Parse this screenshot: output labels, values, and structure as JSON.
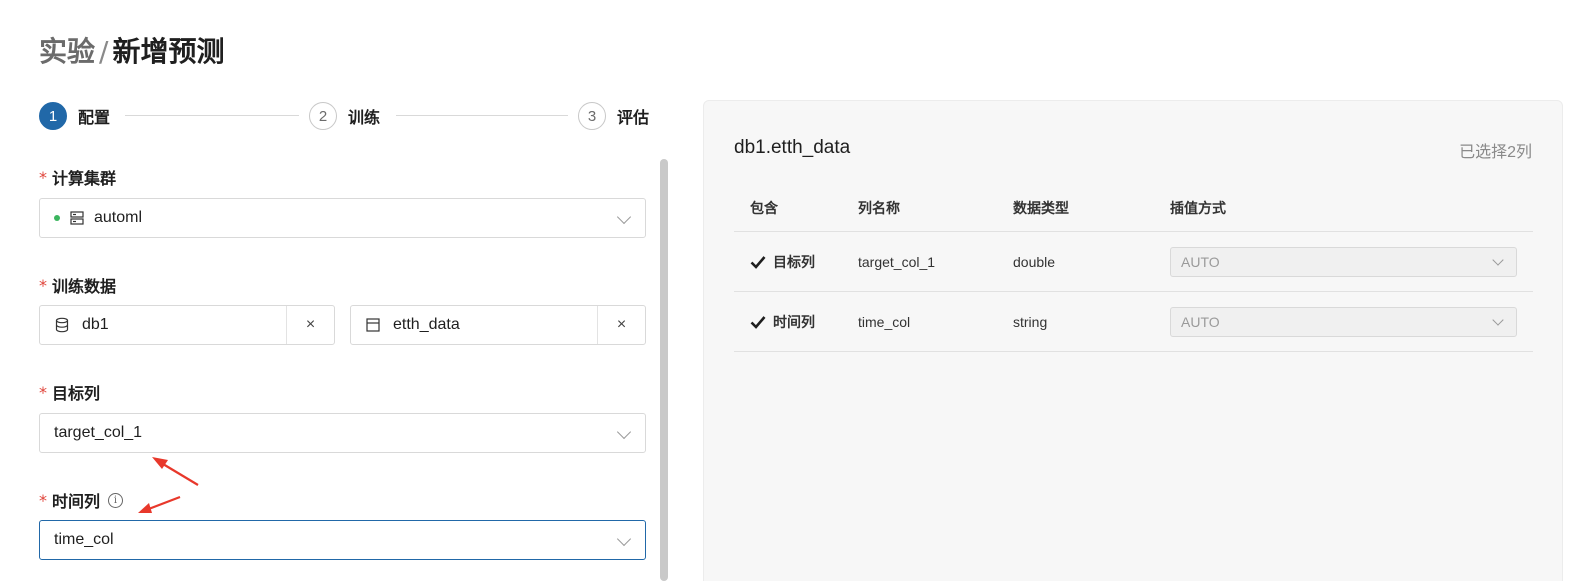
{
  "breadcrumb": {
    "parent": "实验",
    "separator": "/",
    "current": "新增预测"
  },
  "stepper": {
    "steps": [
      {
        "number": "1",
        "label": "配置",
        "active": true
      },
      {
        "number": "2",
        "label": "训练",
        "active": false
      },
      {
        "number": "3",
        "label": "评估",
        "active": false
      }
    ]
  },
  "form": {
    "required_mark": "*",
    "cluster": {
      "label": "计算集群",
      "value": "automl",
      "status": "online",
      "status_color": "#3bb55e"
    },
    "training_data": {
      "label": "训练数据",
      "database": "db1",
      "table": "etth_data",
      "clear_symbol": "×"
    },
    "target_column": {
      "label": "目标列",
      "value": "target_col_1"
    },
    "time_column": {
      "label": "时间列",
      "value": "time_col",
      "info_icon": "i"
    }
  },
  "panel": {
    "title": "db1.etth_data",
    "selected_count": "已选择2列",
    "table": {
      "headers": {
        "include": "包含",
        "name": "列名称",
        "type": "数据类型",
        "interp": "插值方式"
      },
      "rows": [
        {
          "include": "目标列",
          "name": "target_col_1",
          "type": "double",
          "interp": "AUTO"
        },
        {
          "include": "时间列",
          "name": "time_col",
          "type": "string",
          "interp": "AUTO"
        }
      ]
    }
  },
  "colors": {
    "accent": "#2168a8",
    "required": "#e0443a",
    "annotation_arrow": "#e8382b"
  }
}
